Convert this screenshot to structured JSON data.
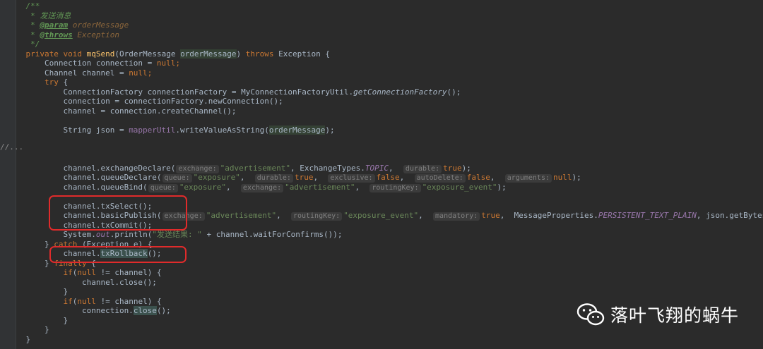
{
  "editor": {
    "colors": {
      "background": "#2b2b2b",
      "comment": "#629755",
      "keyword": "#cc7832",
      "method_decl": "#ffc66d",
      "string": "#6a8759",
      "plain": "#a9b7c6",
      "static_italic": "#9876aa",
      "highlight_red": "#e02b2b"
    },
    "fold_stub": "//...",
    "lines": [
      [
        {
          "t": "    /**",
          "c": "comment"
        }
      ],
      [
        {
          "t": "     * 发送消息",
          "c": "comment"
        }
      ],
      [
        {
          "t": "     * ",
          "c": "comment"
        },
        {
          "t": "@param",
          "c": "doctag"
        },
        {
          "t": " orderMessage",
          "c": "docparam"
        }
      ],
      [
        {
          "t": "     * ",
          "c": "comment"
        },
        {
          "t": "@throws",
          "c": "doctag"
        },
        {
          "t": " Exception",
          "c": "docparam"
        }
      ],
      [
        {
          "t": "     */",
          "c": "comment"
        }
      ],
      [
        {
          "t": "    private void ",
          "c": "keyword"
        },
        {
          "t": "mqSend",
          "c": "method"
        },
        {
          "t": "(OrderMessage ",
          "c": "plain"
        },
        {
          "t": "orderMessage",
          "c": "paramhl"
        },
        {
          "t": ") ",
          "c": "plain"
        },
        {
          "t": "throws ",
          "c": "keyword"
        },
        {
          "t": "Exception {",
          "c": "plain"
        }
      ],
      [
        {
          "t": "        Connection connection = ",
          "c": "plain"
        },
        {
          "t": "null",
          "c": "keyword"
        },
        {
          "t": ";",
          "c": "keyword"
        }
      ],
      [
        {
          "t": "        Channel channel = ",
          "c": "plain"
        },
        {
          "t": "null",
          "c": "keyword"
        },
        {
          "t": ";",
          "c": "keyword"
        }
      ],
      [
        {
          "t": "        try ",
          "c": "keyword"
        },
        {
          "t": "{",
          "c": "plain"
        }
      ],
      [
        {
          "t": "            ConnectionFactory connectionFactory = MyConnectionFactoryUtil.",
          "c": "plain"
        },
        {
          "t": "getConnectionFactory",
          "c": "italic"
        },
        {
          "t": "();",
          "c": "plain"
        }
      ],
      [
        {
          "t": "            connection = connectionFactory.newConnection();",
          "c": "plain"
        }
      ],
      [
        {
          "t": "            channel = connection.createChannel();",
          "c": "plain"
        }
      ],
      [
        {
          "t": "",
          "c": "plain"
        }
      ],
      [
        {
          "t": "            String json = ",
          "c": "plain"
        },
        {
          "t": "mapperUtil",
          "c": "field"
        },
        {
          "t": ".writeValueAsString(",
          "c": "plain"
        },
        {
          "t": "orderMessage",
          "c": "paramhl"
        },
        {
          "t": ");",
          "c": "plain"
        }
      ],
      [
        {
          "t": "",
          "c": "plain"
        }
      ],
      [
        {
          "t": "",
          "c": "plain"
        }
      ],
      [
        {
          "t": "",
          "c": "plain"
        }
      ],
      [
        {
          "t": "            channel.exchangeDeclare(",
          "c": "plain"
        },
        {
          "h": "exchange:"
        },
        {
          "t": "\"advertisement\"",
          "c": "string"
        },
        {
          "t": ", ExchangeTypes.",
          "c": "plain"
        },
        {
          "t": "TOPIC",
          "c": "static"
        },
        {
          "t": ",  ",
          "c": "plain"
        },
        {
          "h": "durable:"
        },
        {
          "t": "true",
          "c": "keyword"
        },
        {
          "t": ");",
          "c": "plain"
        }
      ],
      [
        {
          "t": "            channel.queueDeclare(",
          "c": "plain"
        },
        {
          "h": "queue:"
        },
        {
          "t": "\"exposure\"",
          "c": "string"
        },
        {
          "t": ",  ",
          "c": "plain"
        },
        {
          "h": "durable:"
        },
        {
          "t": "true",
          "c": "keyword"
        },
        {
          "t": ",  ",
          "c": "plain"
        },
        {
          "h": "exclusive:"
        },
        {
          "t": "false",
          "c": "keyword"
        },
        {
          "t": ",  ",
          "c": "plain"
        },
        {
          "h": "autoDelete:"
        },
        {
          "t": "false",
          "c": "keyword"
        },
        {
          "t": ",  ",
          "c": "plain"
        },
        {
          "h": "arguments:"
        },
        {
          "t": "null",
          "c": "keyword"
        },
        {
          "t": ");",
          "c": "plain"
        }
      ],
      [
        {
          "t": "            channel.queueBind(",
          "c": "plain"
        },
        {
          "h": "queue:"
        },
        {
          "t": "\"exposure\"",
          "c": "string"
        },
        {
          "t": ",  ",
          "c": "plain"
        },
        {
          "h": "exchange:"
        },
        {
          "t": "\"advertisement\"",
          "c": "string"
        },
        {
          "t": ",  ",
          "c": "plain"
        },
        {
          "h": "routingKey:"
        },
        {
          "t": "\"exposure_event\"",
          "c": "string"
        },
        {
          "t": ");",
          "c": "plain"
        }
      ],
      [
        {
          "t": "",
          "c": "plain"
        }
      ],
      [
        {
          "t": "            channel.txSelect();",
          "c": "plain"
        }
      ],
      [
        {
          "t": "            channel.basicPublish(",
          "c": "plain"
        },
        {
          "h": "exchange:"
        },
        {
          "t": "\"advertisement\"",
          "c": "string"
        },
        {
          "t": ",  ",
          "c": "plain"
        },
        {
          "h": "routingKey:"
        },
        {
          "t": "\"exposure_event\"",
          "c": "string"
        },
        {
          "t": ",  ",
          "c": "plain"
        },
        {
          "h": "mandatory:"
        },
        {
          "t": "true",
          "c": "keyword"
        },
        {
          "t": ",  MessageProperties.",
          "c": "plain"
        },
        {
          "t": "PERSISTENT_TEXT_PLAIN",
          "c": "static"
        },
        {
          "t": ", json.getBytes());",
          "c": "plain"
        }
      ],
      [
        {
          "t": "            channel.txCommit();",
          "c": "plain"
        }
      ],
      [
        {
          "t": "            System.",
          "c": "plain"
        },
        {
          "t": "out",
          "c": "static"
        },
        {
          "t": ".println(",
          "c": "plain"
        },
        {
          "t": "\"发送结果: \"",
          "c": "string"
        },
        {
          "t": " + channel.waitForConfirms());",
          "c": "plain"
        }
      ],
      [
        {
          "t": "        } ",
          "c": "plain"
        },
        {
          "t": "catch ",
          "c": "keyword"
        },
        {
          "t": "(Exception e) {",
          "c": "plain"
        }
      ],
      [
        {
          "t": "            channel.",
          "c": "plain"
        },
        {
          "t": "txRollback",
          "c": "callhl"
        },
        {
          "t": "();",
          "c": "plain"
        }
      ],
      [
        {
          "t": "        } ",
          "c": "plain"
        },
        {
          "t": "finally ",
          "c": "keyword"
        },
        {
          "t": "{",
          "c": "plain"
        }
      ],
      [
        {
          "t": "            ",
          "c": "plain"
        },
        {
          "t": "if",
          "c": "keyword"
        },
        {
          "t": "(",
          "c": "plain"
        },
        {
          "t": "null ",
          "c": "keyword"
        },
        {
          "t": "!= channel) {",
          "c": "plain"
        }
      ],
      [
        {
          "t": "                channel.close();",
          "c": "plain"
        }
      ],
      [
        {
          "t": "            }",
          "c": "plain"
        }
      ],
      [
        {
          "t": "            ",
          "c": "plain"
        },
        {
          "t": "if",
          "c": "keyword"
        },
        {
          "t": "(",
          "c": "plain"
        },
        {
          "t": "null ",
          "c": "keyword"
        },
        {
          "t": "!= channel) {",
          "c": "plain"
        }
      ],
      [
        {
          "t": "                connection.",
          "c": "plain"
        },
        {
          "t": "close",
          "c": "callhl"
        },
        {
          "t": "();",
          "c": "plain"
        }
      ],
      [
        {
          "t": "            }",
          "c": "plain"
        }
      ],
      [
        {
          "t": "        }",
          "c": "plain"
        }
      ],
      [
        {
          "t": "    }",
          "c": "plain"
        }
      ]
    ]
  },
  "watermark": {
    "text": "落叶飞翔的蜗牛",
    "icon": "wechat-icon"
  }
}
